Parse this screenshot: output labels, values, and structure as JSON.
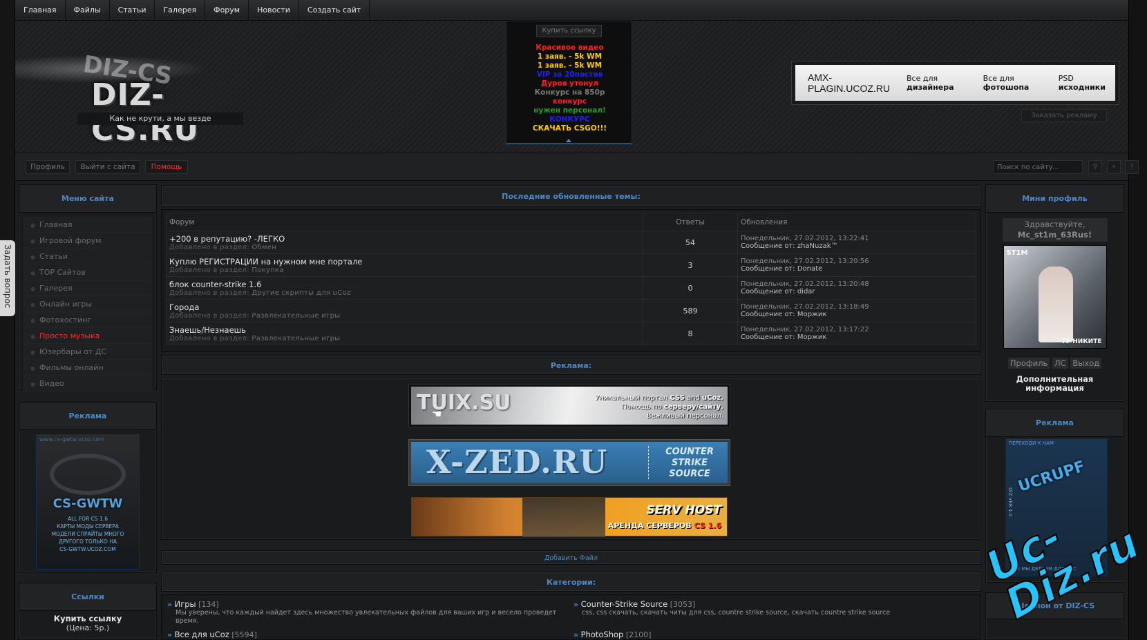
{
  "nav": [
    "Главная",
    "Файлы",
    "Статьи",
    "Галерея",
    "Форум",
    "Новости",
    "Создать сайт"
  ],
  "logo": {
    "text": "DIZ-CS.RU",
    "slogan": "Как не крути, а мы везде"
  },
  "ad_block": {
    "buy_link": "Купить ссылку",
    "lines": [
      {
        "text": "Красивое видео",
        "color": "#ff2020"
      },
      {
        "text": "1 заяв. - 5k WM",
        "color": "#ffcc00"
      },
      {
        "text": "1 заяв. - 5k WM",
        "color": "#ffcc00"
      },
      {
        "text": "VIP за 20постов",
        "color": "#2020ff"
      },
      {
        "text": "Дуров утонул",
        "color": "#ff2020"
      },
      {
        "text": "Конкурс на 850р",
        "color": "#7a7a7a"
      },
      {
        "text": "конкурс",
        "color": "#ff2020"
      },
      {
        "text": "нужен персонал!",
        "color": "#20a020"
      },
      {
        "text": "КОНКУРС",
        "color": "#2020ff"
      },
      {
        "text": "СКАЧАТЬ CSGO!!!",
        "color": "#ffcc00"
      }
    ]
  },
  "banner_amx": {
    "site": "AMX-PLAGIN.UCOZ.RU",
    "t1": "Все для",
    "t1b": "дизайнера",
    "t2": "Все для",
    "t2b": "фотошопа",
    "t3": "PSD",
    "t3b": "исходники"
  },
  "order_ad": "Заказать рекламу",
  "userbar": {
    "profile": "Профиль",
    "logout": "Выйти с сайта",
    "help": "Помощь",
    "search_placeholder": "Поиск по сайту...",
    "search_icon": "magnifier-icon",
    "rss_icon": "rss-icon",
    "help_icon": "question-icon"
  },
  "side_tab": "Задать вопрос",
  "left": {
    "menu_title": "Меню сайта",
    "menu": [
      "Главная",
      "Игровой форум",
      "Статьи",
      "TOP Сайтов",
      "Галерея",
      "Онлайн игры",
      "Фотохостинг",
      "Просто музыка",
      "Юзербары от ДС",
      "Фильмы онлайн",
      "Видео"
    ],
    "menu_active_index": 7,
    "ad_title": "Реклама",
    "ad_banner": {
      "top": "www.cs-gwtw.ucoz.com",
      "logo": "CS-GWTW",
      "lines": [
        "ALL FOR CS 1.6",
        "КАРТЫ МОДЫ СЕРВЕРА",
        "МОДЕЛИ СПРАЙТЫ МНОГО",
        "ДРУГОГО ТОЛЬКО НА",
        "CS-GWTW.UCOZ.COM"
      ]
    },
    "links_title": "Ссылки",
    "links_buy": "Купить ссылку",
    "links_price": "(Цена: 5р.)"
  },
  "center": {
    "latest_title": "Последние обновленные темы:",
    "table_headers": [
      "Форум",
      "Ответы",
      "Обновления"
    ],
    "added_label": "Добавлено в раздел:",
    "from_label": "Сообщение от:",
    "topics": [
      {
        "title": "+200 в репутацию? -ЛЕГКО",
        "section": "Обмен",
        "replies": "54",
        "date": "Понедельник, 27.02.2012, 13:22:41",
        "author": "zhaNuzak™"
      },
      {
        "title": "Куплю РЕГИСТРАЦИИ на нужном мне портале",
        "section": "Покупка",
        "replies": "3",
        "date": "Понедельник, 27.02.2012, 13:20:56",
        "author": "Donate"
      },
      {
        "title": "блок counter-strike 1.6",
        "section": "Другие скрипты для uCoz",
        "replies": "0",
        "date": "Понедельник, 27.02.2012, 13:20:48",
        "author": "didar"
      },
      {
        "title": "Города",
        "section": "Развлекательные игры",
        "replies": "589",
        "date": "Понедельник, 27.02.2012, 13:18:49",
        "author": "Моржик"
      },
      {
        "title": "Знаешь/Незнаешь",
        "section": "Развлекательные игры",
        "replies": "8",
        "date": "Понедельник, 27.02.2012, 13:17:22",
        "author": "Моржик"
      }
    ],
    "ads_title": "Реклама:",
    "ad1": {
      "logo": "TUIX.SU",
      "l1a": "Уникальный портал",
      "l1b": "CSS",
      "l1c": "and",
      "l1d": "uCoz.",
      "l2a": "Помощь по",
      "l2b": "серверу/сайту.",
      "l3": "Вежливый персонал."
    },
    "ad2": {
      "logo": "X-ZED.RU",
      "l1": "COUNTER",
      "l2": "STRIKE",
      "l3": "SOURCE"
    },
    "ad3": {
      "logo": "SERV HOST",
      "sub": "АРЕНДА СЕРВЕРОВ",
      "sub2": "CS 1.6"
    },
    "add_file": "Добавить Файл",
    "categories_title": "Категории:",
    "categories": [
      {
        "name": "Игры",
        "count": "[134]",
        "desc": "Мы уверены, что каждый найдет здесь множество увлекательных файлов для ваших игр и весело проведет время."
      },
      {
        "name": "Counter-Strike Source",
        "count": "[3053]",
        "desc": "css, css скачать, скачать читы для css, countre strike source, скачать countre strike source"
      },
      {
        "name": "Все для uCoz",
        "count": "[5594]",
        "desc": ""
      },
      {
        "name": "PhotoShop",
        "count": "[2100]",
        "desc": ""
      }
    ]
  },
  "right": {
    "mini_title": "Мини профиль",
    "greeting": "Здравствуйте,",
    "username": "Mc_st1m_63Rus!",
    "avatar_tag": "ST1M",
    "avatar_caption": "ТУ НИКИТЕ",
    "links": [
      "Профиль",
      "ЛС",
      "Выход"
    ],
    "more": "Дополнительная информация",
    "ad_title": "Реклама",
    "ad_banner": {
      "top": "ПЕРЕХОДИ К НАМ",
      "logo": "UCRUPF",
      "side": "DIZ VER 4.0",
      "bottom": "ВСЕ МЫ ДЕЛАЕМ ДЛЯ ВАС"
    },
    "templates_title": "Шаблон от DIZ-CS"
  },
  "watermark": "Uc-Diz.ru",
  "colors": {
    "accent": "#4b89c8",
    "active_menu": "#ff2a2a",
    "watermark": "#27c3ff"
  }
}
